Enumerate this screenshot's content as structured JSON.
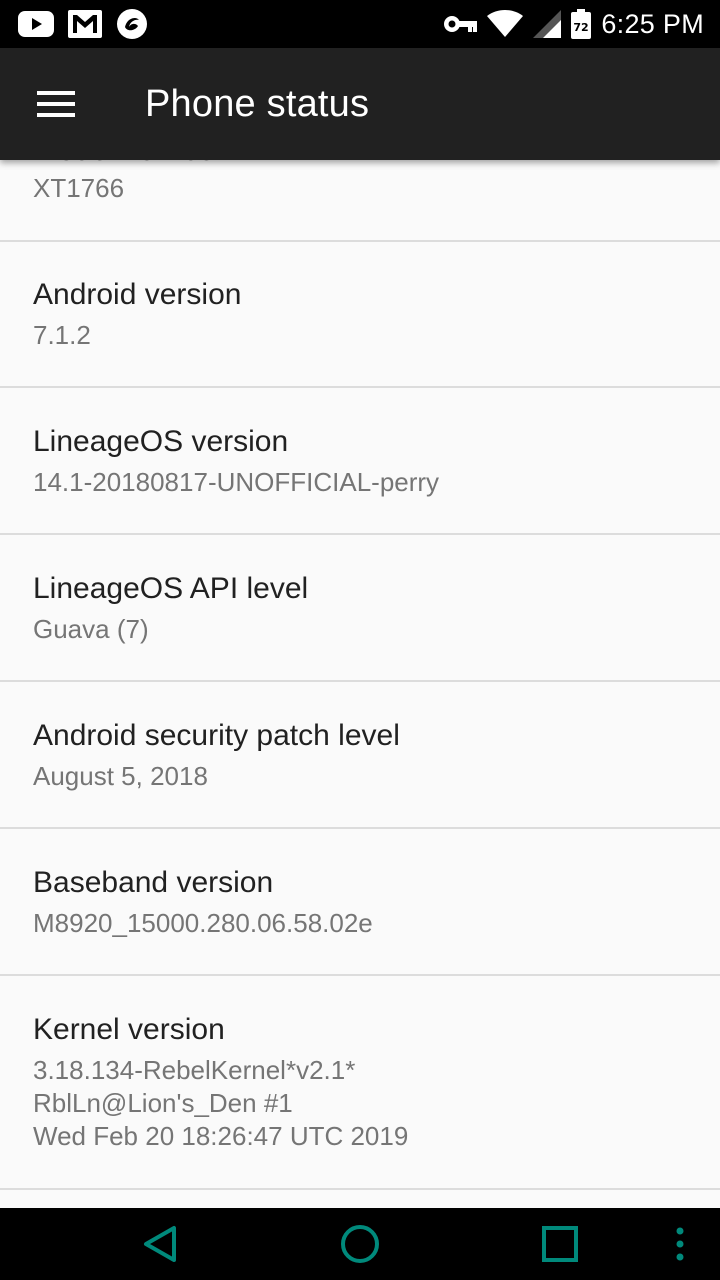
{
  "status_bar": {
    "time": "6:25 PM",
    "battery_level": "72",
    "icons_left": [
      "youtube-icon",
      "gmail-icon",
      "app-icon"
    ],
    "icons_right": [
      "vpn-key-icon",
      "wifi-icon",
      "signal-icon",
      "battery-icon"
    ]
  },
  "app_bar": {
    "title": "Phone status",
    "menu_icon": "menu-icon"
  },
  "list": {
    "partial_item": {
      "title": "Model number",
      "value": "XT1766"
    },
    "items": [
      {
        "title": "Android version",
        "value": "7.1.2"
      },
      {
        "title": "LineageOS version",
        "value": "14.1-20180817-UNOFFICIAL-perry"
      },
      {
        "title": "LineageOS API level",
        "value": "Guava (7)"
      },
      {
        "title": "Android security patch level",
        "value": "August 5, 2018"
      },
      {
        "title": "Baseband version",
        "value": "M8920_15000.280.06.58.02e"
      },
      {
        "title": "Kernel version",
        "value_lines": [
          "3.18.134-RebelKernel*v2.1*",
          "RblLn@Lion's_Den #1",
          "Wed Feb 20 18:26:47 UTC 2019"
        ]
      }
    ]
  },
  "nav_bar": {
    "buttons": [
      "back-icon",
      "home-icon",
      "recents-icon",
      "overflow-icon"
    ]
  },
  "colors": {
    "status_bar": "#000000",
    "app_bar": "#212121",
    "background": "#fafafa",
    "title_text": "#212121",
    "summary_text": "#757575",
    "divider": "#dcdcdc",
    "nav_icons": "#00897b"
  }
}
